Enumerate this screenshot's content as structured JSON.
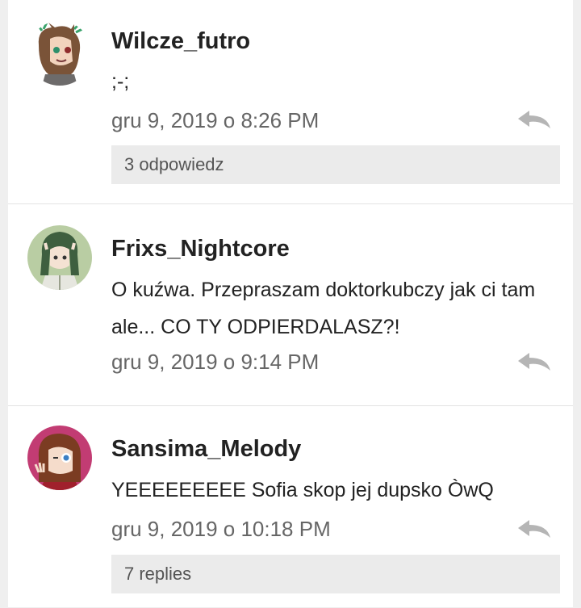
{
  "comments": [
    {
      "author": "Wilcze_futro",
      "text": ";-;",
      "timestamp": "gru 9, 2019 o 8:26 PM",
      "replies_label": "3 odpowiedz",
      "avatar": "avatar-wolf-girl"
    },
    {
      "author": "Frixs_Nightcore",
      "text": "O kuźwa. Przepraszam doktorkubczy jak ci tam ale... CO TY ODPIERDALASZ?!",
      "timestamp": "gru 9, 2019 o 9:14 PM",
      "replies_label": "",
      "avatar": "avatar-green-hair"
    },
    {
      "author": "Sansima_Melody",
      "text": "YEEEEEEEEE Sofia skop jej dupsko ÒwQ",
      "timestamp": "gru 9, 2019 o 10:18 PM",
      "replies_label": "7 replies",
      "avatar": "avatar-brown-hair"
    }
  ],
  "icons": {
    "reply": "reply-arrow-icon"
  },
  "colors": {
    "text": "#222222",
    "meta": "#666666",
    "replies_bg": "#ebebeb",
    "icon": "#b5b5b5"
  }
}
